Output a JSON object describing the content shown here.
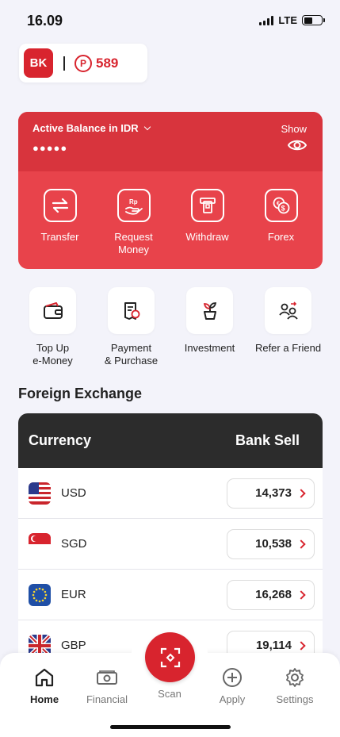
{
  "status_bar": {
    "time": "16.09",
    "network": "LTE"
  },
  "brand": {
    "logo_text": "BK",
    "points_symbol": "P",
    "points": "589"
  },
  "balance_card": {
    "label": "Active Balance in IDR",
    "masked_value": "●●●●●",
    "show_label": "Show",
    "actions": [
      {
        "label": "Transfer",
        "icon": "transfer-icon"
      },
      {
        "label": "Request\nMoney",
        "icon": "request-money-icon"
      },
      {
        "label": "Withdraw",
        "icon": "withdraw-icon"
      },
      {
        "label": "Forex",
        "icon": "forex-icon"
      }
    ]
  },
  "quick_menu": [
    {
      "label": "Top Up\ne-Money",
      "icon": "wallet-icon"
    },
    {
      "label": "Payment\n& Purchase",
      "icon": "receipt-icon"
    },
    {
      "label": "Investment",
      "icon": "plant-icon"
    },
    {
      "label": "Refer a Friend",
      "icon": "refer-friend-icon"
    }
  ],
  "forex": {
    "title": "Foreign Exchange",
    "col_currency": "Currency",
    "col_sell": "Bank Sell",
    "rows": [
      {
        "currency": "USD",
        "rate": "14,373"
      },
      {
        "currency": "SGD",
        "rate": "10,538"
      },
      {
        "currency": "EUR",
        "rate": "16,268"
      },
      {
        "currency": "GBP",
        "rate": "19,114"
      }
    ]
  },
  "bottom_nav": {
    "items": [
      {
        "label": "Home",
        "icon": "home-icon",
        "active": true
      },
      {
        "label": "Financial",
        "icon": "money-icon",
        "active": false
      },
      {
        "label": "Scan",
        "icon": "scan-icon",
        "active": false
      },
      {
        "label": "Apply",
        "icon": "plus-circle-icon",
        "active": false
      },
      {
        "label": "Settings",
        "icon": "gear-icon",
        "active": false
      }
    ]
  },
  "colors": {
    "brand_red": "#d8242e",
    "card_red": "#e8434b",
    "table_header": "#2c2c2c"
  }
}
